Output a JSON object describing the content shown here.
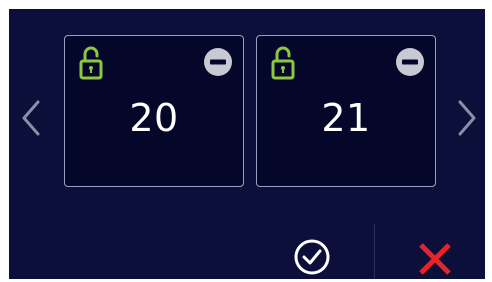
{
  "navigation": {
    "prev_icon": "chevron-left-icon",
    "next_icon": "chevron-right-icon"
  },
  "cards": [
    {
      "number": "20",
      "lock_icon": "unlocked-padlock-icon",
      "remove_icon": "minus-circle-icon"
    },
    {
      "number": "21",
      "lock_icon": "unlocked-padlock-icon",
      "remove_icon": "minus-circle-icon"
    }
  ],
  "actions": {
    "confirm_icon": "check-circle-icon",
    "cancel_icon": "close-x-icon"
  },
  "colors": {
    "background": "#0b0f3a",
    "card_background": "#05072a",
    "card_border": "#9aa0c4",
    "lock_green": "#8dc63f",
    "remove_gray": "#c8c9d2",
    "confirm_white": "#ffffff",
    "cancel_red": "#e8242a",
    "arrow_gray": "#8a8ea6"
  }
}
